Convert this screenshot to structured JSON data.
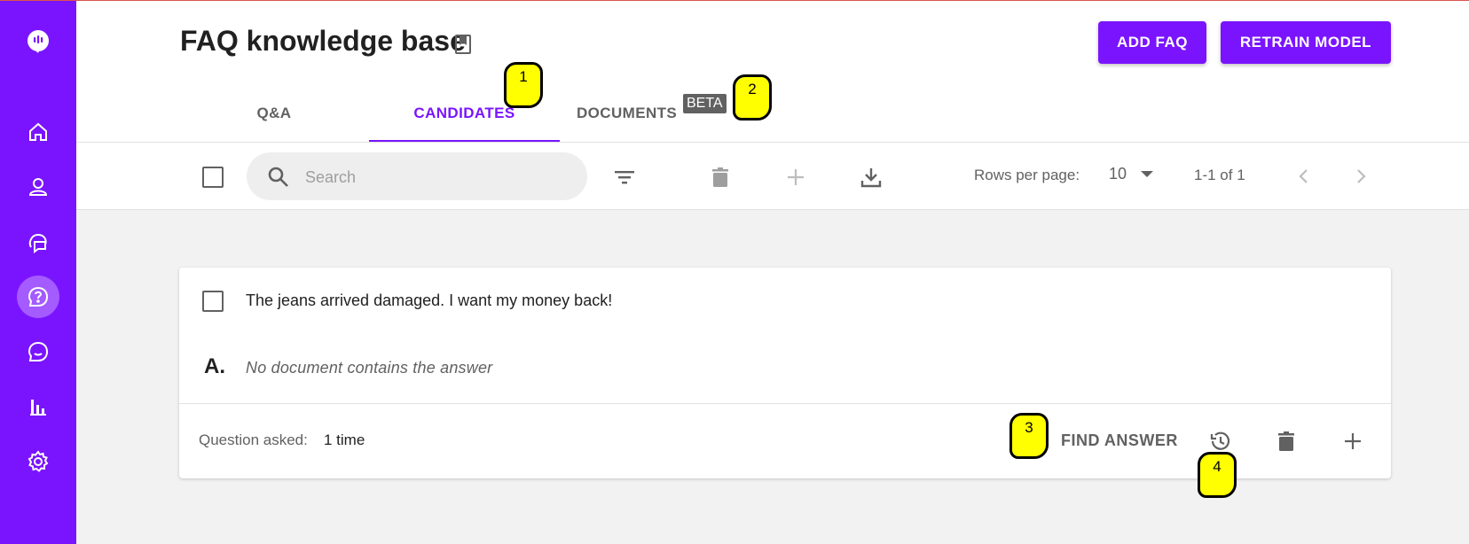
{
  "header": {
    "title": "FAQ knowledge base",
    "add_faq_label": "ADD FAQ",
    "retrain_label": "RETRAIN MODEL"
  },
  "tabs": [
    {
      "label": "Q&A",
      "active": false
    },
    {
      "label": "CANDIDATES",
      "active": true
    },
    {
      "label": "DOCUMENTS",
      "active": false,
      "badge": "BETA"
    }
  ],
  "toolbar": {
    "search_placeholder": "Search",
    "rows_per_page_label": "Rows per page:",
    "rows_per_page_value": "10",
    "range_label": "1-1 of 1"
  },
  "card": {
    "question": "The jeans arrived damaged. I want my money back!",
    "answer_prefix": "A.",
    "answer": "No document contains the answer",
    "asked_label": "Question asked:",
    "asked_value": "1 time",
    "find_answer_label": "FIND ANSWER"
  },
  "sidebar": {
    "items": [
      {
        "icon": "home-icon"
      },
      {
        "icon": "user-icon"
      },
      {
        "icon": "chat-icon"
      },
      {
        "icon": "faq-icon",
        "active": true
      },
      {
        "icon": "conversation-icon"
      },
      {
        "icon": "analytics-icon"
      },
      {
        "icon": "gear-icon"
      }
    ]
  },
  "annotations": [
    "1",
    "2",
    "3",
    "4"
  ],
  "colors": {
    "brand": "#7a14ff",
    "brand_active": "#a45bff",
    "marker": "#ffff00"
  }
}
